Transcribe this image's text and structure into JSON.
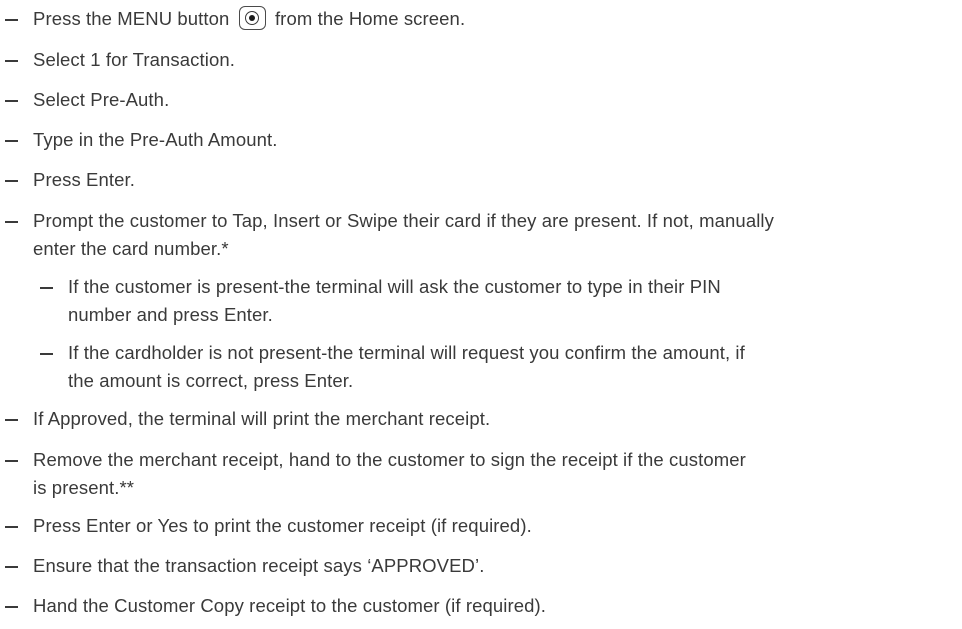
{
  "steps": [
    {
      "before_icon": "Press the MENU button",
      "icon": "menu-button-icon",
      "after_icon": "from the Home screen."
    },
    {
      "lines": [
        "Select 1 for Transaction."
      ]
    },
    {
      "lines": [
        "Select Pre-Auth."
      ]
    },
    {
      "lines": [
        "Type in the Pre-Auth Amount."
      ]
    },
    {
      "lines": [
        "Press Enter."
      ]
    },
    {
      "lines": [
        "Prompt the customer to Tap, Insert or Swipe their card if they are present. If not, manually",
        "enter the card number.*"
      ],
      "substeps": [
        {
          "lines": [
            "If the customer is present-the terminal will ask the customer to type in their PIN",
            "number and press Enter."
          ]
        },
        {
          "lines": [
            "If the cardholder is not present-the terminal will request you confirm the amount, if",
            "the amount is correct, press Enter."
          ]
        }
      ]
    },
    {
      "lines": [
        "If Approved, the terminal will print the merchant receipt."
      ]
    },
    {
      "lines": [
        "Remove the merchant receipt, hand to the customer to sign the receipt if the customer",
        "is present.**"
      ]
    },
    {
      "lines": [
        "Press Enter or Yes to print the customer receipt (if required)."
      ]
    },
    {
      "lines": [
        "Ensure that the transaction receipt says ‘APPROVED’."
      ]
    },
    {
      "lines": [
        "Hand the Customer Copy receipt to the customer (if required)."
      ]
    }
  ]
}
